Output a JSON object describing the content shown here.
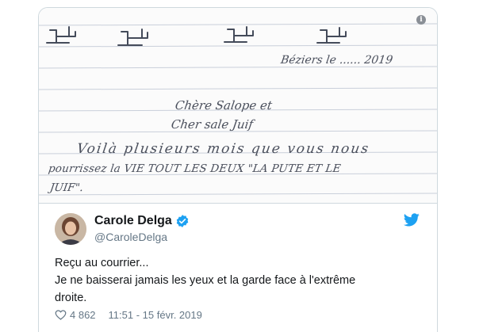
{
  "tweet": {
    "letter": {
      "date_line": "Béziers le ...... 2019",
      "salutation_line1": "Chère Salope et",
      "salutation_line2": "Cher sale Juif",
      "body_line1": "Voilà plusieurs mois que vous nous",
      "body_line2": "pourrissez la VIE TOUT LES DEUX \"LA PUTE ET LE",
      "body_line3": "JUIF\"."
    },
    "author": {
      "name": "Carole Delga",
      "handle": "@CaroleDelga",
      "verified": true
    },
    "text_lines": [
      "Reçu au courrier...",
      "Je ne baisserai jamais les yeux et la garde face à l'extrême",
      "droite."
    ],
    "likes": "4 862",
    "timestamp": "11:51 - 15 févr. 2019"
  },
  "icons": {
    "info": "info-icon",
    "verified": "verified-badge-icon",
    "brand": "twitter-bird-icon",
    "like": "heart-icon"
  },
  "colors": {
    "twitter_blue": "#1da1f2",
    "verified_blue": "#1da1f2",
    "text_primary": "#14171a",
    "text_secondary": "#657786",
    "border": "#cfd9de"
  }
}
